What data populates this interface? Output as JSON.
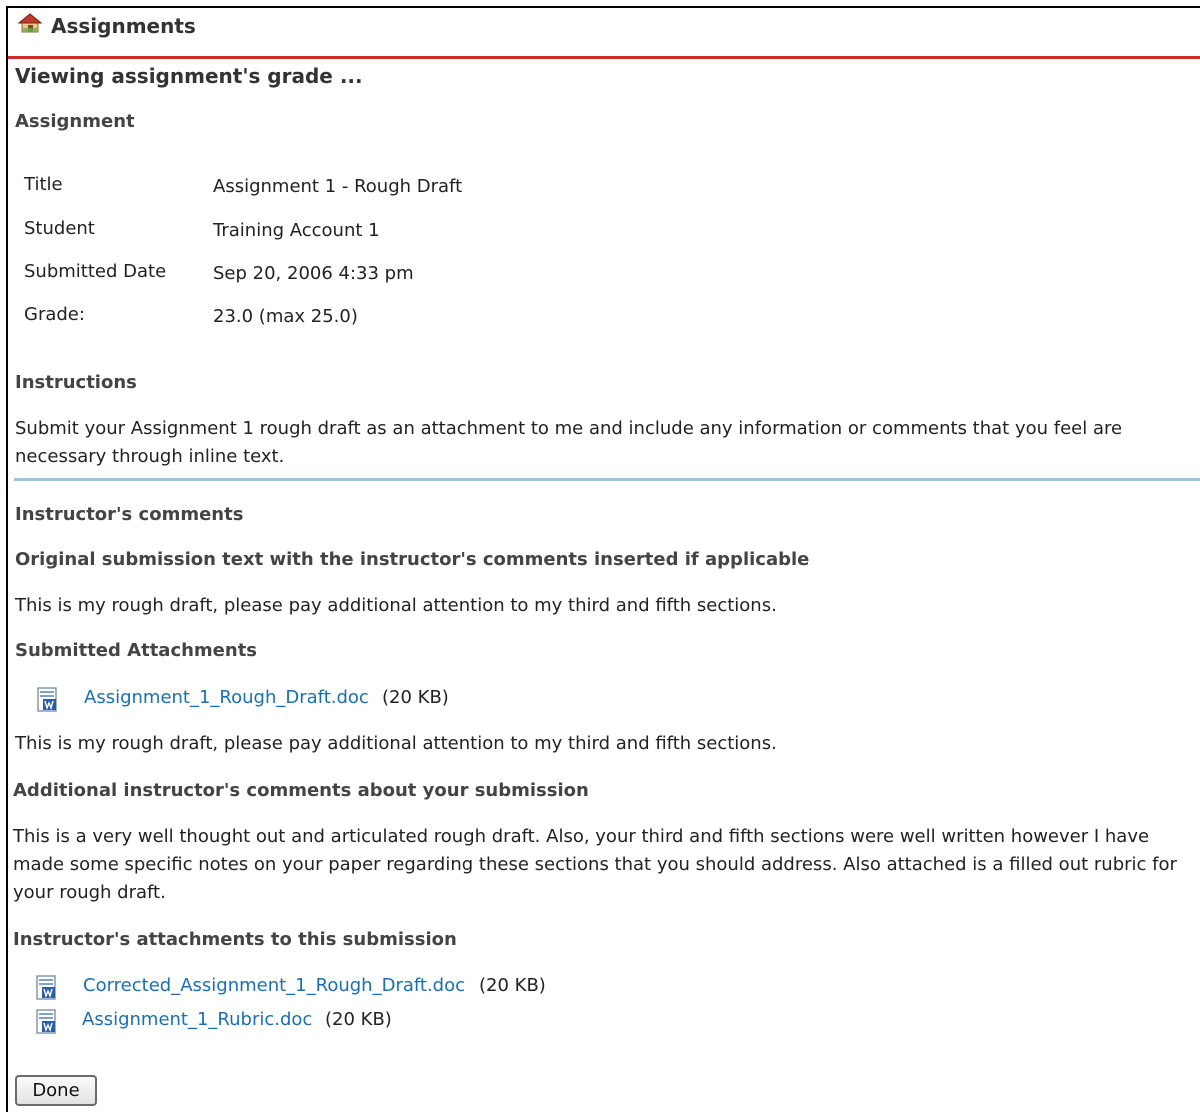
{
  "header": {
    "title": "Assignments",
    "icon": "home-icon",
    "rule_color": "#cc2b2b"
  },
  "page_heading": "Viewing assignment's grade ...",
  "assignment": {
    "heading": "Assignment",
    "rows": [
      {
        "label": "Title",
        "value": "Assignment 1 - Rough Draft"
      },
      {
        "label": "Student",
        "value": "Training Account 1"
      },
      {
        "label": "Submitted Date",
        "value": "Sep 20, 2006 4:33 pm"
      },
      {
        "label": "Grade:",
        "value": "23.0 (max 25.0)"
      }
    ]
  },
  "instructions": {
    "heading": "Instructions",
    "line1": "Submit your Assignment 1 rough draft as an attachment to me and include any information or comments that you feel are",
    "line2": "necessary through inline text."
  },
  "instructor_comments": {
    "heading": "Instructor's comments",
    "original_heading": "Original submission text with the instructor's comments inserted if applicable",
    "original_text": "This is my rough draft, please pay additional attention to my third and fifth sections."
  },
  "submitted_attachments": {
    "heading": "Submitted Attachments",
    "items": [
      {
        "name": "Assignment_1_Rough_Draft.doc",
        "size": "(20 KB)",
        "icon": "word-doc-icon"
      }
    ],
    "text_after": "This is my rough draft, please pay additional attention to my third and fifth sections."
  },
  "additional_comments": {
    "heading": "Additional instructor's comments about your submission",
    "line1": "This is a very well thought out and articulated rough draft.  Also, your third and fifth sections were well written however I have",
    "line2": "made some specific notes on your paper regarding these sections that you should address.  Also attached is a filled out rubric for",
    "line3": "your rough draft."
  },
  "instructor_attachments": {
    "heading": "Instructor's attachments to this submission",
    "items": [
      {
        "name": "Corrected_Assignment_1_Rough_Draft.doc",
        "size": "(20 KB)",
        "icon": "word-doc-icon"
      },
      {
        "name": "Assignment_1_Rubric.doc",
        "size": "(20 KB)",
        "icon": "word-doc-icon"
      }
    ]
  },
  "done_label": "Done",
  "colors": {
    "link": "#1a6fb4",
    "divider": "#9ec3de"
  }
}
